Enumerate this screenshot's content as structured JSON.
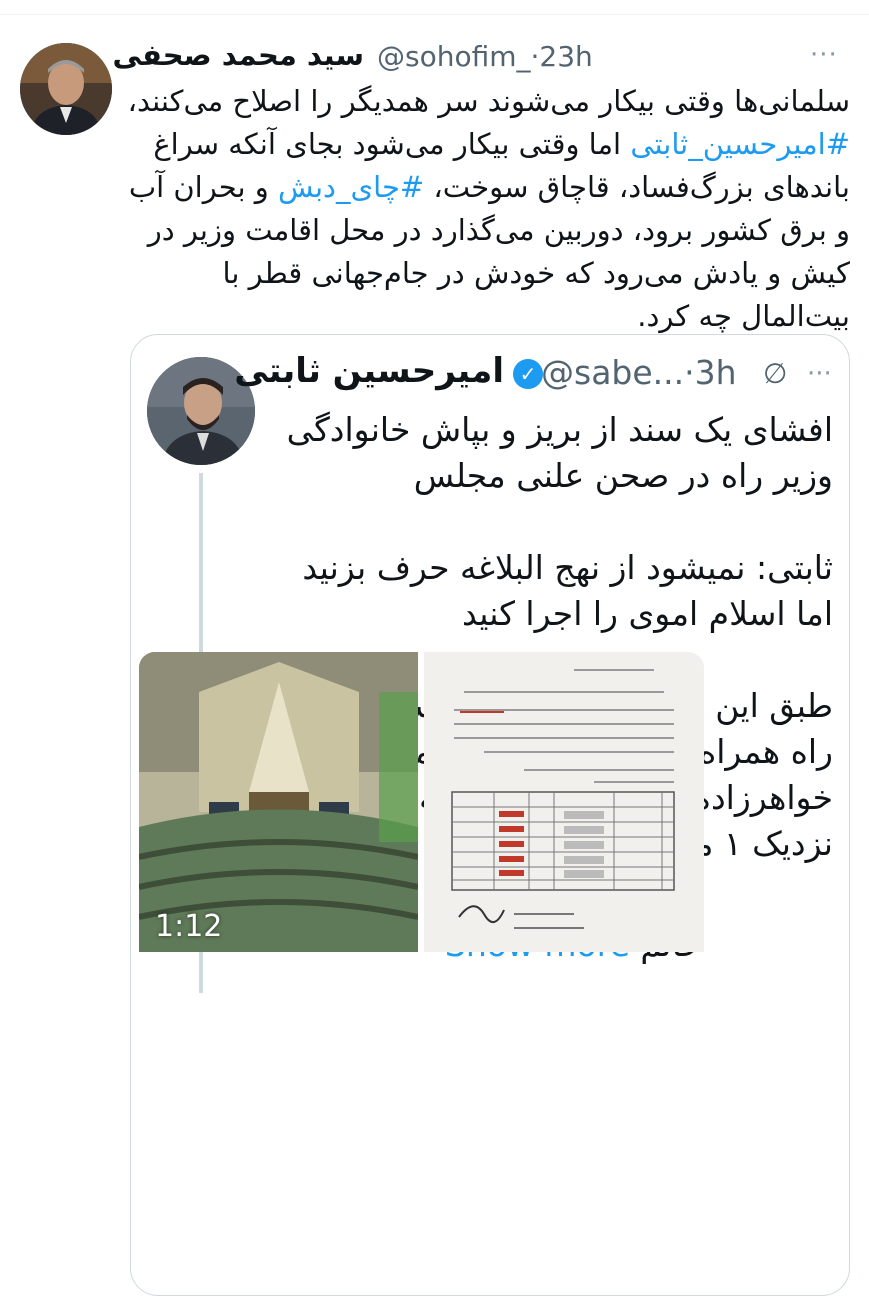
{
  "tweet": {
    "author_name": "سید محمد صحفی",
    "handle": "@sohofim_",
    "time": "23h",
    "more": "···",
    "text_lines": [
      "سلمانی‌ها وقتی بیکار می‌شوند سر همدیگر را اصلاح می‌کنند،",
      "اما وقتی بیکار می‌شود بجای آنکه سراغ",
      "باندهای بزرگ‌فساد، قاچاق سوخت،",
      "و بحران آب",
      "و برق کشور برود، دوربین می‌گذارد در محل اقامت وزیر در",
      "کیش و یادش می‌رود که خودش در جام‌جهانی قطر با",
      "بیت‌المال چه کرد."
    ],
    "hashtag_1": "#امیرحسین_ثابتی",
    "hashtag_2": "#چای_دبش"
  },
  "quote": {
    "author_name": "امیرحسین ثابتی",
    "handle": "@sabe...",
    "time": "3h",
    "more": "···",
    "mute_icon": "∅",
    "verified_icon": "✓",
    "paragraph_1": [
      "افشای یک سند از بریز و بپاش خانوادگی",
      "وزیر راه در صحن علنی مجلس"
    ],
    "paragraph_2": [
      "ثابتی: نمیشود از نهج البلاغه حرف بزنید",
      "اما اسلام اموی را اجرا کنید"
    ],
    "paragraph_3": [
      "طبق این سندی که به دستم رسیده وزیر",
      "راه همراه با همسر، فرزند، داماد، خواهر و",
      "خواهرزاده هایش به کیش رفته و این سفر",
      "نزدیک ۱ میلیارد هزینه داشته"
    ],
    "trailing_word": "خانم",
    "show_more": "Show more",
    "video_time": "1:12"
  },
  "colors": {
    "link": "#1d9bf0",
    "text": "#0f1419",
    "secondary": "#536471",
    "border": "#cfd9de"
  }
}
